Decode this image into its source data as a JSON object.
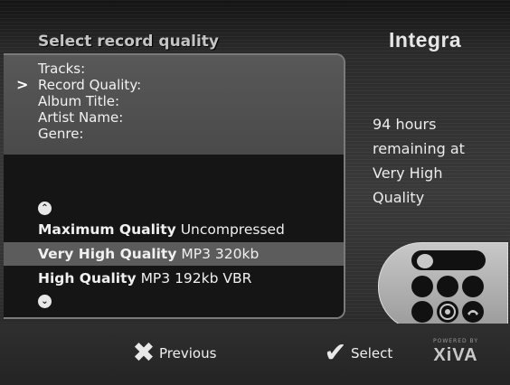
{
  "header": {
    "title": "Select record quality",
    "brand": "Integra"
  },
  "fields": {
    "pointer": ">",
    "items": [
      "Tracks:",
      "Record Quality:",
      "Album Title:",
      "Artist Name:",
      "Genre:"
    ],
    "active_index": 1
  },
  "scroll": {
    "up_icon": "chevron-up-icon",
    "down_icon": "chevron-down-icon"
  },
  "quality_options": [
    {
      "name": "Maximum Quality",
      "detail": "Uncompressed"
    },
    {
      "name": "Very High Quality",
      "detail": "MP3 320kb",
      "selected": true
    },
    {
      "name": "High Quality",
      "detail": "MP3 192kb VBR"
    }
  ],
  "info": {
    "lines": [
      "94 hours",
      "remaining at",
      "Very High",
      "Quality"
    ]
  },
  "footer": {
    "previous_label": "Previous",
    "select_label": "Select",
    "previous_icon": "close-x-icon",
    "select_icon": "checkmark-icon",
    "powered_by": "POWERED BY",
    "logo": "XiVA"
  },
  "colors": {
    "background": "#2e2e2e",
    "panel": "#151515",
    "selected_row": "#5c5c5c",
    "text": "#f0f0f0"
  }
}
